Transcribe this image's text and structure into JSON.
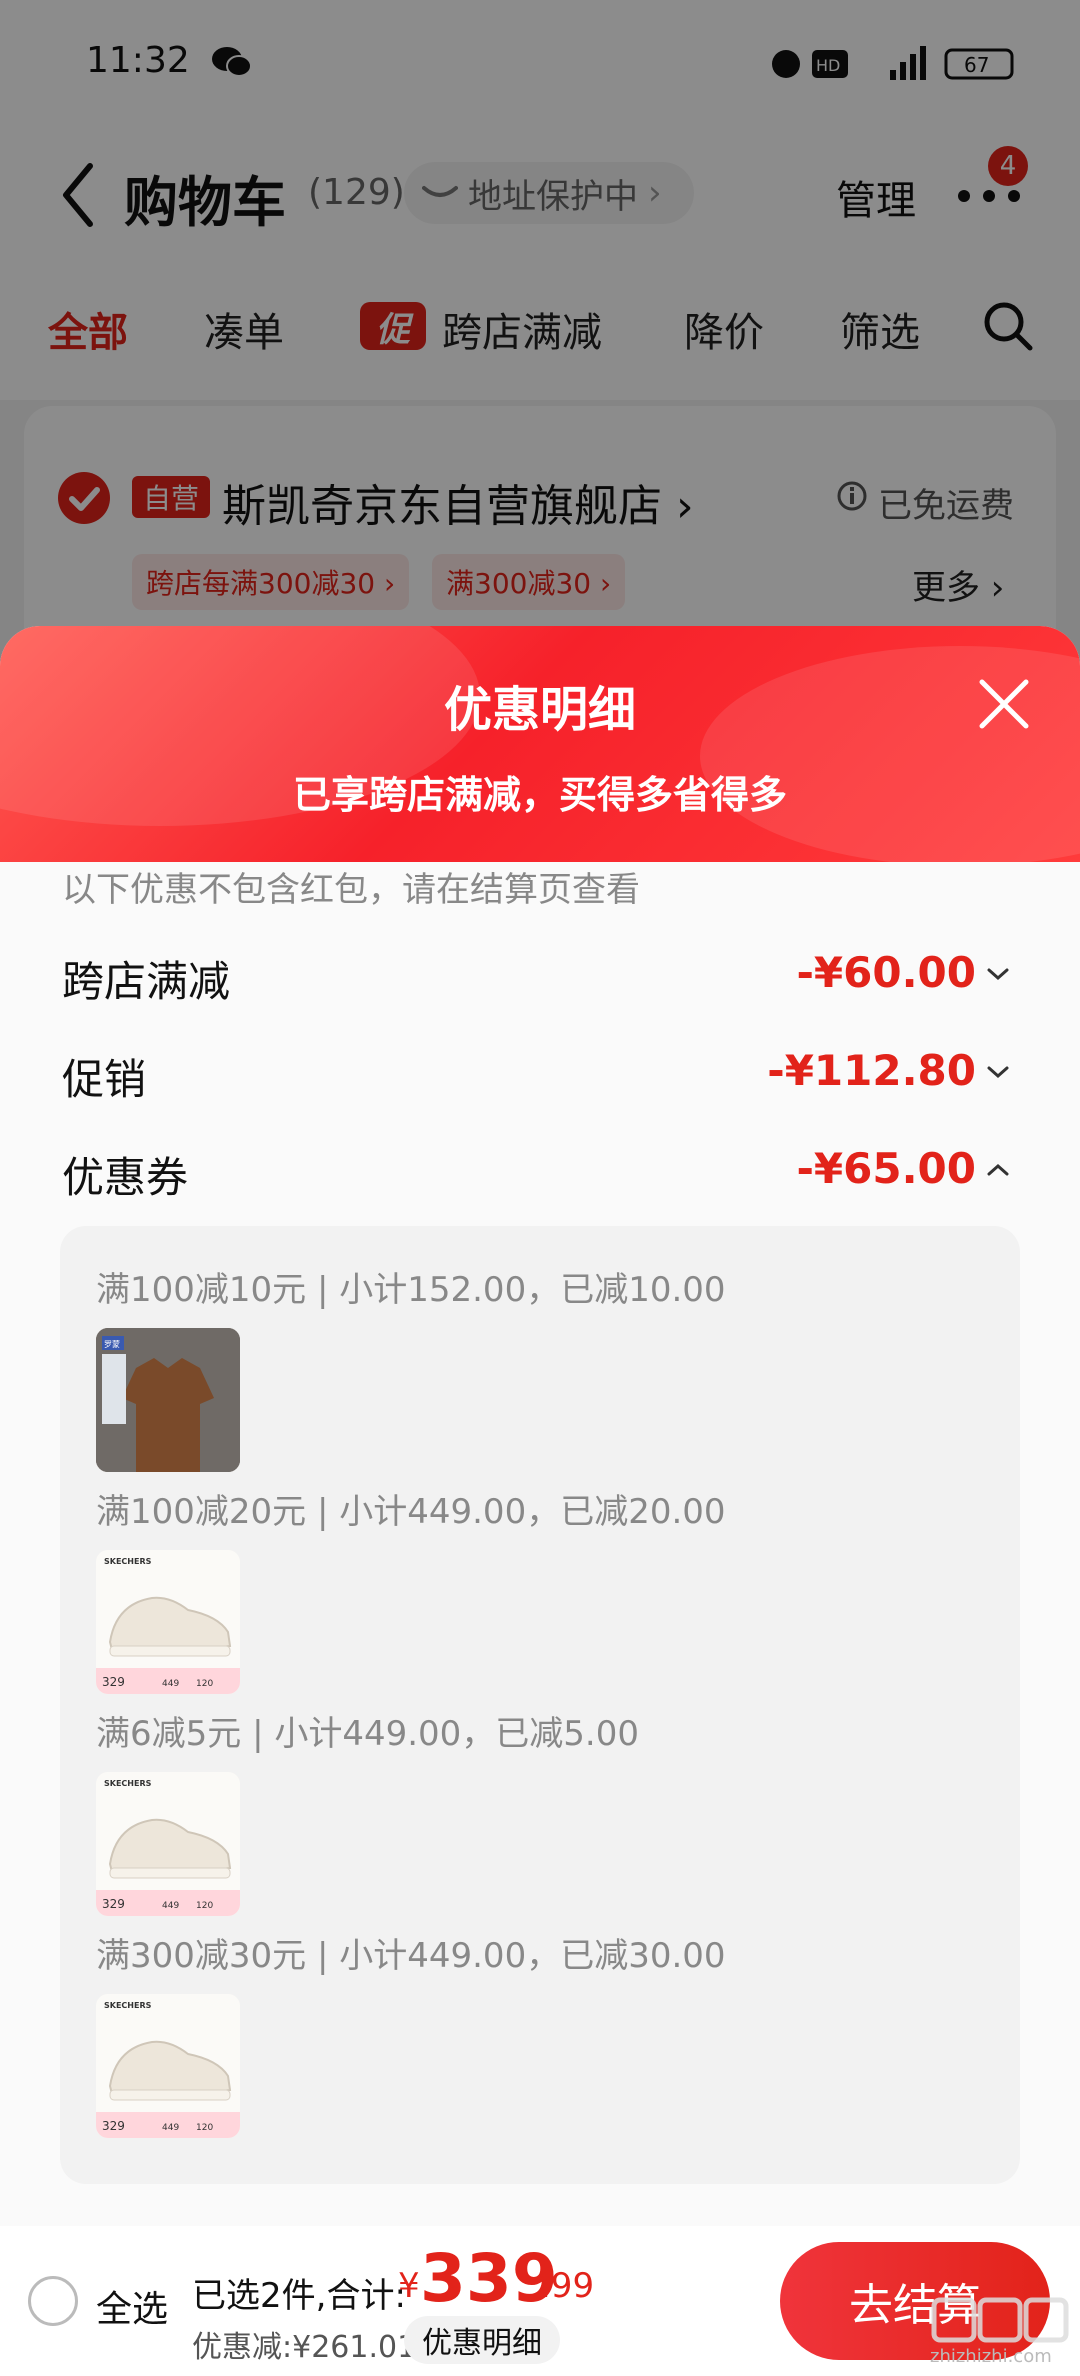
{
  "status": {
    "time": "11:32",
    "battery": "67"
  },
  "header": {
    "title": "购物车",
    "count": "(129)",
    "address_pill": "地址保护中",
    "manage": "管理",
    "badge": "4"
  },
  "tabs": [
    {
      "label": "全部",
      "active": true
    },
    {
      "label": "凑单"
    },
    {
      "label": "跨店满减",
      "tag": "促"
    },
    {
      "label": "降价"
    },
    {
      "label": "筛选"
    }
  ],
  "store": {
    "tag": "自营",
    "name": "斯凯奇京东自营旗舰店 ›",
    "shipping": "已免运费",
    "chips": [
      "跨店每满300减30 ›",
      "满300减30 ›"
    ],
    "more": "更多 ›"
  },
  "sheet": {
    "title": "优惠明细",
    "subtitle": "已享跨店满减，买得多省得多",
    "note": "以下优惠不包含红包，请在结算页查看",
    "rows": [
      {
        "label": "跨店满减",
        "value": "-¥60.00"
      },
      {
        "label": "促销",
        "value": "-¥112.80"
      },
      {
        "label": "优惠券",
        "value": "-¥65.00"
      }
    ],
    "coupons": [
      {
        "line": "满100减10元 | 小计152.00，已减10.00",
        "product": "shirt"
      },
      {
        "line": "满100减20元 | 小计449.00，已减20.00",
        "product": "shoe"
      },
      {
        "line": "满6减5元 | 小计449.00，已减5.00",
        "product": "shoe"
      },
      {
        "line": "满300减30元 | 小计449.00，已减30.00",
        "product": "shoe"
      }
    ],
    "thumb_brand": "SKECHERS",
    "thumb_price": "329",
    "thumb_price2": "449",
    "thumb_price3": "120",
    "shirt_brand": "罗蒙"
  },
  "bottom": {
    "select_all": "全选",
    "selected": "已选2件,合计:",
    "currency": "¥",
    "total_int": "339",
    "total_dec": ".99",
    "discount": "优惠减:¥261.01",
    "discount_btn": "优惠明细",
    "checkout": "去结算"
  },
  "watermark": {
    "text": "zhizhizhi.com"
  },
  "colors": {
    "accent": "#e2231a",
    "chip_bg": "#fde8e6"
  }
}
